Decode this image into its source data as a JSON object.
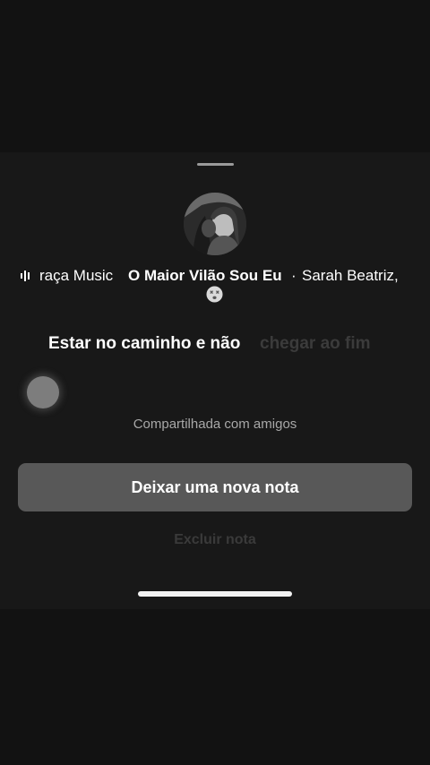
{
  "note_sheet": {
    "music": {
      "artist_partial": "raça Music",
      "song_title": "O Maior Vilão Sou Eu",
      "separator": "·",
      "featured_artist": "Sarah Beatriz,"
    },
    "lyric": {
      "sung": "Estar no caminho e não",
      "upcoming": "chegar ao fim"
    },
    "visibility_label": "Compartilhada com amigos",
    "new_note_button": "Deixar uma nova nota",
    "delete_link": "Excluir nota"
  },
  "icons": {
    "music_bars": "audio-bars-icon",
    "emoji": "dizzy-face-emoji-icon",
    "record": "record-dot-icon"
  }
}
